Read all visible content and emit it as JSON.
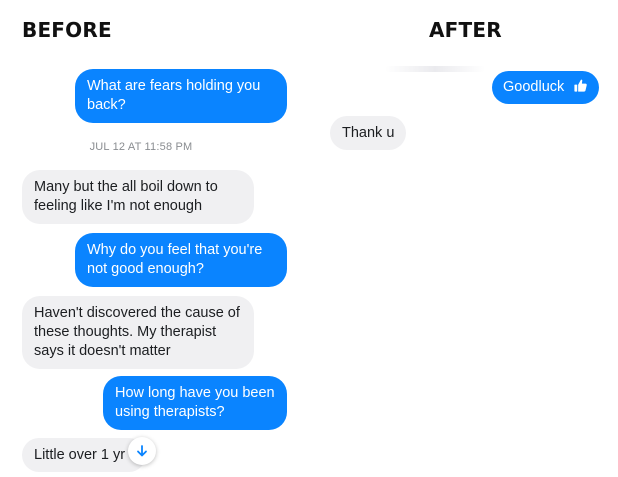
{
  "panels": {
    "before_title": "BEFORE",
    "after_title": "AFTER"
  },
  "before": {
    "messages": [
      {
        "side": "sent",
        "text": "What are fears holding you back?"
      },
      {
        "side": "timestamp",
        "text": "JUL 12 AT 11:58 PM"
      },
      {
        "side": "received",
        "text": "Many but the all boil down to feeling like I'm not enough"
      },
      {
        "side": "sent",
        "text": "Why do you feel that you're not good enough?"
      },
      {
        "side": "received",
        "text": "Haven't discovered the cause of these thoughts. My therapist says it doesn't matter"
      },
      {
        "side": "sent",
        "text": "How long have you been using therapists?"
      },
      {
        "side": "received",
        "text": "Little over 1 yr"
      }
    ],
    "scroll_button_icon": "arrow-down-icon"
  },
  "after": {
    "messages": [
      {
        "side": "sent",
        "text": "Goodluck",
        "icon": "thumbs-up-icon"
      },
      {
        "side": "received",
        "text": "Thank u"
      }
    ]
  },
  "colors": {
    "sent_bubble": "#0a84ff",
    "received_bubble": "#f0f0f2",
    "timestamp_text": "#8a8d91"
  }
}
